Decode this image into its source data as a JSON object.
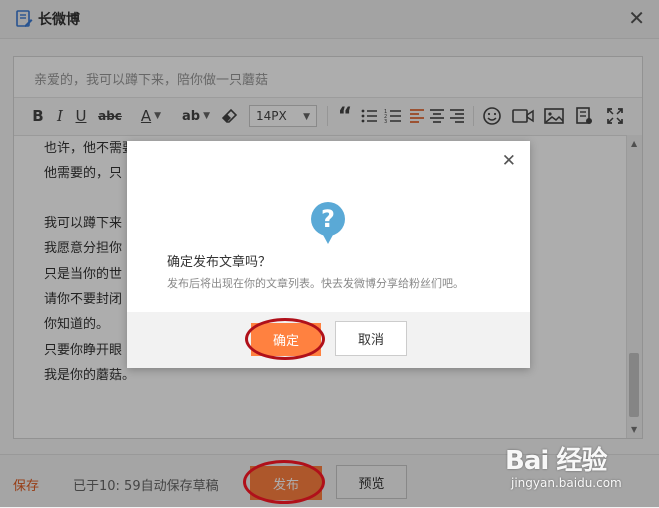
{
  "window": {
    "title": "长微博",
    "close_symbol": "✕"
  },
  "editor": {
    "title_placeholder": "亲爱的，我可以蹲下来，陪你做一只蘑菇",
    "toolbar": {
      "bold": "B",
      "italic": "I",
      "underline": "U",
      "strike": "abc",
      "font_color": "A",
      "bg_color": "ab",
      "font_size": "14PX",
      "quote": "“"
    },
    "content_lines": [
      "也许，他不需要",
      "他需要的，只",
      "",
      "我可以蹲下来",
      "我愿意分担你",
      "只是当你的世",
      "请你不要封闭",
      "你知道的。",
      "只要你睁开眼",
      "我是你的蘑菇。"
    ]
  },
  "footer": {
    "save_label": "保存",
    "autosave_text": "已于10: 59自动保存草稿",
    "publish_label": "发布",
    "preview_label": "预览"
  },
  "dialog": {
    "title": "确定发布文章吗？",
    "subtitle": "发布后将出现在你的文章列表。快去发微博分享给粉丝们吧。",
    "ok_label": "确定",
    "cancel_label": "取消",
    "close_symbol": "✕",
    "icon_glyph": "?"
  },
  "watermark": {
    "logo": "Bai 经验",
    "url": "jingyan.baidu.com"
  },
  "colors": {
    "accent": "#ff8140",
    "save_link": "#e05a1f",
    "info_icon": "#5aa9d6",
    "annotation": "#b0101a"
  }
}
